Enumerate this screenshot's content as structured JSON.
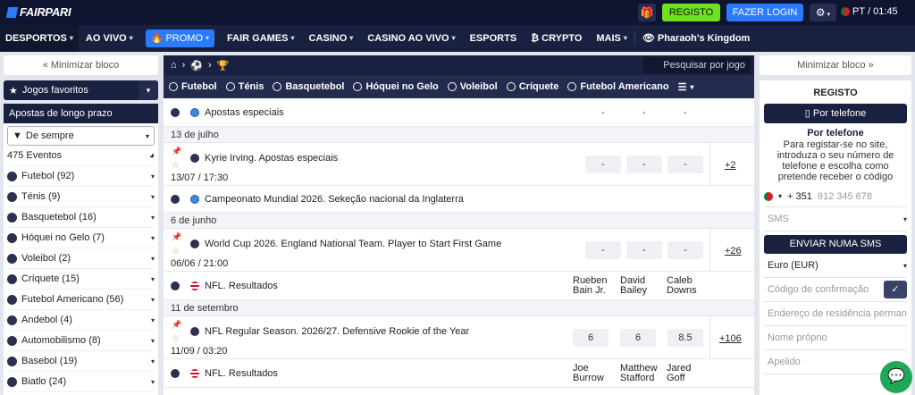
{
  "top": {
    "logo": "FAIRPARI",
    "register": "REGISTO",
    "login": "FAZER LOGIN",
    "lang": "PT",
    "time": "01:45"
  },
  "nav": {
    "items": [
      "DESPORTOS",
      "AO VIVO",
      "PROMO",
      "FAIR GAMES",
      "CASINO",
      "CASINO AO VIVO",
      "ESPORTS",
      "CRYPTO",
      "MAIS",
      "Pharaoh's Kingdom"
    ]
  },
  "left": {
    "minimize": "« Minimizar bloco",
    "favorites": "Jogos favoritos",
    "long_term": "Apostas de longo prazo",
    "period": "De sempre",
    "events_count": "475 Eventos",
    "sports": [
      "Futebol (92)",
      "Ténis (9)",
      "Basquetebol (16)",
      "Hóquei no Gelo (7)",
      "Voleibol (2)",
      "Críquete (15)",
      "Futebol Americano (56)",
      "Andebol (4)",
      "Automobilismo (8)",
      "Basebol (19)",
      "Biatlo (24)"
    ]
  },
  "center": {
    "search_placeholder": "Pesquisar por jogo",
    "sports_tabs": [
      "Futebol",
      "Ténis",
      "Basquetebol",
      "Hóquei no Gelo",
      "Voleibol",
      "Críquete",
      "Futebol Americano"
    ],
    "rows": {
      "r1_title": "Apostas especiais",
      "d1": "13 de julho",
      "r2_title": "Kyrie Irving. Apostas especiais",
      "r2_time": "13/07 / 17:30",
      "r2_more": "+2",
      "r3_title": "Campeonato Mundial 2026. Sekeção nacional da Inglaterra",
      "d2": "6 de junho",
      "r4_title": "World Cup 2026. England National Team. Player to Start First Game",
      "r4_time": "06/06 / 21:00",
      "r4_more": "+26",
      "r5_title": "NFL. Resultados",
      "r5_c1": "Rueben Bain Jr.",
      "r5_c2": "David Bailey",
      "r5_c3": "Caleb Downs",
      "d3": "11 de setembro",
      "r6_title": "NFL Regular Season. 2026/27. Defensive Rookie of the Year",
      "r6_time": "11/09 / 03:20",
      "r6_o1": "6",
      "r6_o2": "6",
      "r6_o3": "8.5",
      "r6_more": "+106",
      "r7_title": "NFL. Resultados",
      "r7_c1": "Joe Burrow",
      "r7_c2": "Matthew Stafford",
      "r7_c3": "Jared Goff",
      "dash": "-"
    }
  },
  "right": {
    "minimize": "Minimizar bloco »",
    "title": "REGISTO",
    "by_phone_btn": "Por telefone",
    "by_phone_title": "Por telefone",
    "hint": "Para registar-se no site, introduza o seu número de telefone e escolha como pretende receber o código",
    "prefix": "+ 351",
    "phone_placeholder": "912 345 678",
    "sms": "SMS",
    "send_sms": "ENVIAR NUMA SMS",
    "currency": "Euro (EUR)",
    "code_placeholder": "Código de confirmação",
    "address_placeholder": "Endereço de residência permanente",
    "first_name_placeholder": "Nome próprio",
    "last_name_placeholder": "Apelido"
  }
}
